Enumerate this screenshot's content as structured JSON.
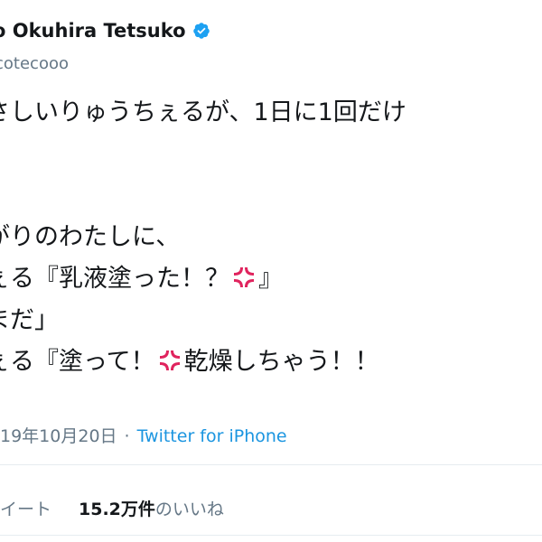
{
  "author": {
    "name": "o Okuhira Tetsuko",
    "handle": "cotecooo",
    "verified": true
  },
  "tweet": {
    "lines": [
      "さしいりゅうちぇるが、1日に1回だけ",
      "。",
      "",
      "がりのわたしに、",
      "ぇる『乳液塗った！？",
      "まだ」",
      "ぇる『塗って！"
    ],
    "line4_end": "』",
    "line6_end": "乾燥しちゃう！！"
  },
  "meta": {
    "date": "19年10月20日",
    "separator": "·",
    "source": "Twitter for iPhone"
  },
  "stats": {
    "retweets_label": "イート",
    "likes_count": "15.2万件",
    "likes_label": "のいいね"
  },
  "colors": {
    "text": "#14171a",
    "secondary": "#657786",
    "link": "#1b95e0",
    "verified": "#1da1f2",
    "anger": "#e0245e",
    "divider": "#e6ecf0"
  },
  "icons": {
    "verified": "verified-badge-icon",
    "anger": "anger-symbol-icon"
  }
}
